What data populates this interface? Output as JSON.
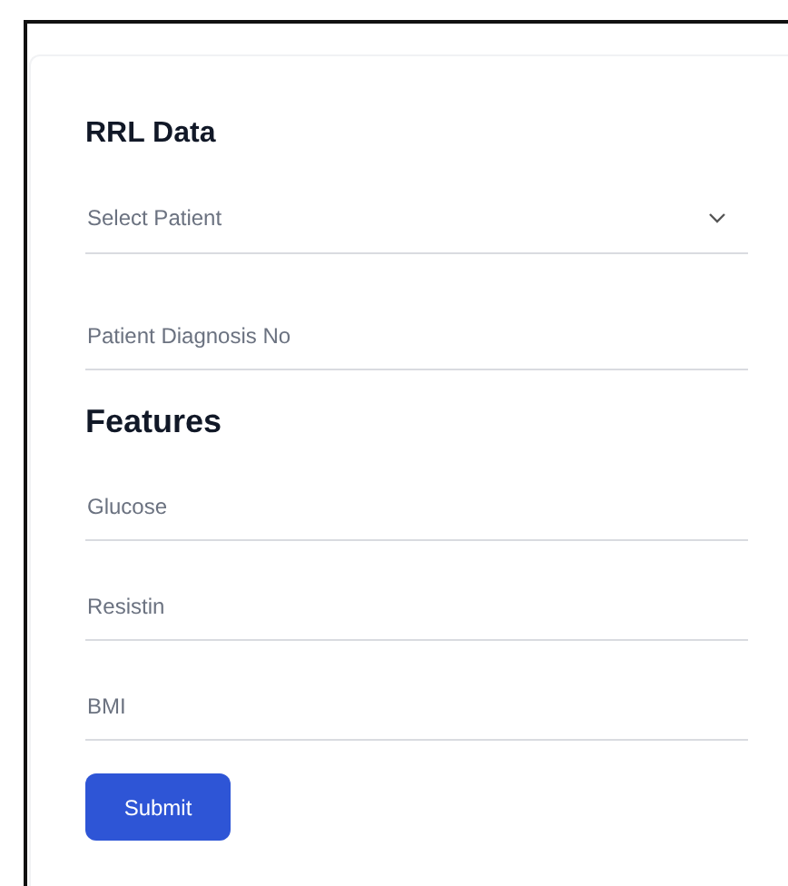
{
  "sections": [
    {
      "heading": "RRL Data",
      "fields": [
        {
          "kind": "select",
          "placeholder": "Select Patient"
        },
        {
          "kind": "text",
          "placeholder": "Patient Diagnosis No"
        }
      ]
    },
    {
      "heading": "Features",
      "fields": [
        {
          "kind": "text",
          "placeholder": "Glucose"
        },
        {
          "kind": "text",
          "placeholder": "Resistin"
        },
        {
          "kind": "text",
          "placeholder": "BMI"
        }
      ]
    }
  ],
  "submit": "Submit"
}
